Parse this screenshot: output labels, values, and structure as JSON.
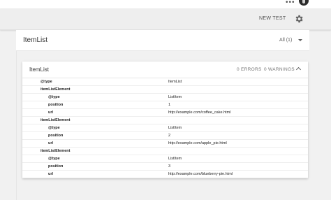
{
  "topbar": {
    "more_glyph": "•••"
  },
  "toolbar": {
    "new_test_label": "NEW TEST",
    "settings_icon": "gear-icon"
  },
  "header": {
    "title": "ItemList",
    "filter_label": "All (1)"
  },
  "panel": {
    "title": "ItemList",
    "errors_label": "0 ERRORS",
    "warnings_label": "0 WARNINGS",
    "rows": [
      {
        "key": "@type",
        "value": "ItemList",
        "level": 1
      },
      {
        "key": "itemListElement",
        "value": "",
        "level": 1
      },
      {
        "key": "@type",
        "value": "ListItem",
        "level": 2
      },
      {
        "key": "position",
        "value": "1",
        "level": 2
      },
      {
        "key": "url",
        "value": "http://example.com/coffee_cake.html",
        "level": 2
      },
      {
        "key": "itemListElement",
        "value": "",
        "level": 1
      },
      {
        "key": "@type",
        "value": "ListItem",
        "level": 2
      },
      {
        "key": "position",
        "value": "2",
        "level": 2
      },
      {
        "key": "url",
        "value": "http://example.com/apple_pie.html",
        "level": 2
      },
      {
        "key": "itemListElement",
        "value": "",
        "level": 1
      },
      {
        "key": "@type",
        "value": "ListItem",
        "level": 2
      },
      {
        "key": "position",
        "value": "3",
        "level": 2
      },
      {
        "key": "url",
        "value": "http://example.com/blueberry-pie.html",
        "level": 2
      }
    ]
  }
}
